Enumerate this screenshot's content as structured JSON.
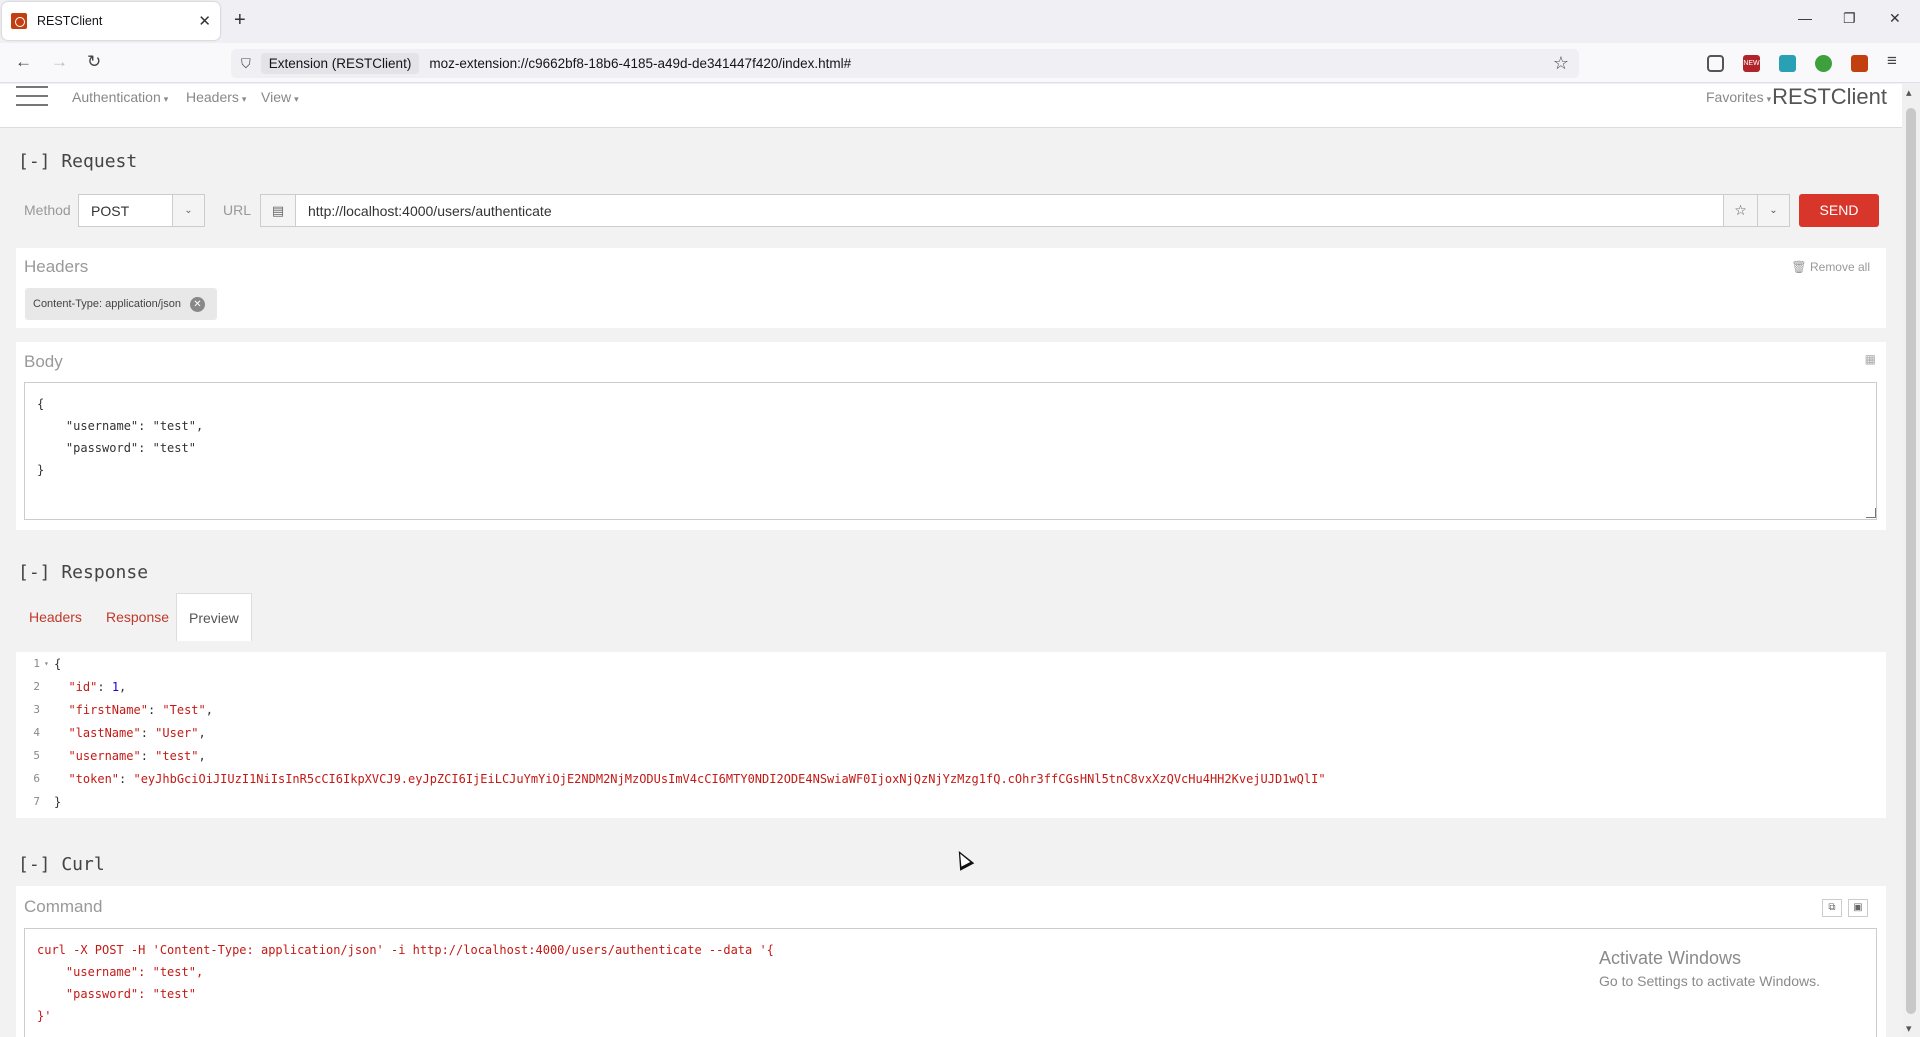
{
  "browser": {
    "tab_title": "RESTClient",
    "tab_close": "✕",
    "new_tab": "+",
    "identity": "Extension (RESTClient)",
    "address": "moz-extension://c9662bf8-18b6-4185-a49d-de341447f420/index.html#",
    "win_min": "—",
    "win_max": "❐",
    "win_close": "✕",
    "ext_badge": "NEW"
  },
  "app": {
    "brand": "RESTClient",
    "menus": {
      "authentication": "Authentication",
      "headers": "Headers",
      "view": "View",
      "favorites": "Favorites"
    },
    "caret": "▾"
  },
  "request": {
    "section_title": "[-] Request",
    "method_label": "Method",
    "method_value": "POST",
    "url_label": "URL",
    "url_value": "http://localhost:4000/users/authenticate",
    "send_label": "SEND",
    "headers_title": "Headers",
    "remove_all": "🗑 Remove all",
    "header_chip": "Content-Type: application/json",
    "body_title": "Body",
    "body_text": "{\n    \"username\": \"test\",\n    \"password\": \"test\"\n}"
  },
  "response": {
    "section_title": "[-] Response",
    "tabs": [
      "Headers",
      "Response",
      "Preview"
    ],
    "active_tab": "Preview",
    "lines": [
      {
        "n": "1",
        "fold": "▾",
        "text": "{"
      },
      {
        "n": "2",
        "key": "\"id\"",
        "val": "1",
        "num": true,
        "comma": ","
      },
      {
        "n": "3",
        "key": "\"firstName\"",
        "val": "\"Test\"",
        "comma": ","
      },
      {
        "n": "4",
        "key": "\"lastName\"",
        "val": "\"User\"",
        "comma": ","
      },
      {
        "n": "5",
        "key": "\"username\"",
        "val": "\"test\"",
        "comma": ","
      },
      {
        "n": "6",
        "key": "\"token\"",
        "val": "\"eyJhbGciOiJIUzI1NiIsInR5cCI6IkpXVCJ9.eyJpZCI6IjEiLCJuYmYiOjE2NDM2NjMzODUsImV4cCI6MTY0NDI2ODE4NSwiaWF0IjoxNjQzNjYzMzg1fQ.cOhr3ffCGsHNl5tnC8vxXzQVcHu4HH2KvejUJD1wQlI\"",
        "comma": ""
      },
      {
        "n": "7",
        "text": "}"
      }
    ]
  },
  "curl": {
    "section_title": "[-] Curl",
    "command_title": "Command",
    "command_text": "curl -X POST -H 'Content-Type: application/json' -i http://localhost:4000/users/authenticate --data '{\n    \"username\": \"test\",\n    \"password\": \"test\"\n}'"
  },
  "watermark": {
    "line1": "Activate Windows",
    "line2": "Go to Settings to activate Windows."
  }
}
